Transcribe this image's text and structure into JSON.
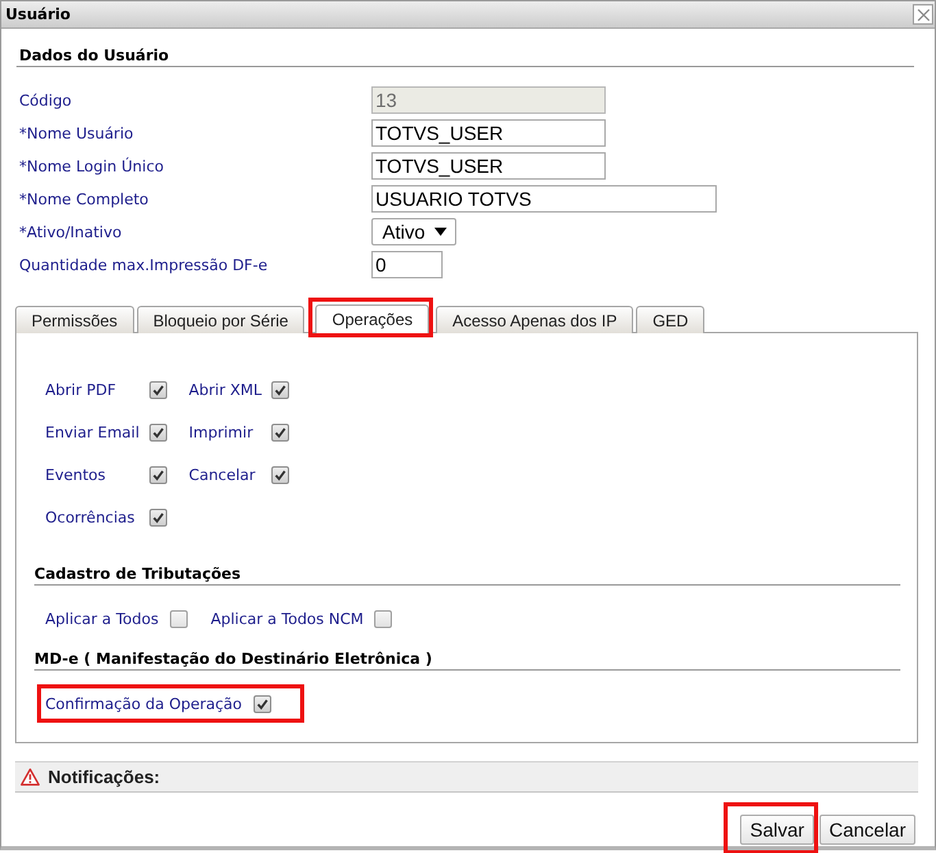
{
  "window": {
    "title": "Usuário"
  },
  "user": {
    "title": "Dados do Usuário",
    "fields": [
      {
        "kind": "text",
        "label": "Código",
        "value": "13",
        "disabled": true
      },
      {
        "kind": "text",
        "label": "*Nome Usuário",
        "value": "TOTVS_USER",
        "disabled": false
      },
      {
        "kind": "text",
        "label": "*Nome Login Único",
        "value": "TOTVS_USER",
        "disabled": false
      },
      {
        "kind": "longtext",
        "label": "*Nome Completo",
        "value": "USUARIO TOTVS",
        "disabled": false
      },
      {
        "kind": "select",
        "label": "*Ativo/Inativo",
        "value": "Ativo",
        "disabled": false
      },
      {
        "kind": "number",
        "label": "Quantidade max.Impressão DF-e",
        "value": "0",
        "disabled": false
      }
    ]
  },
  "tabs": [
    {
      "label": "Permissões",
      "selected": false,
      "highlighted": false
    },
    {
      "label": "Bloqueio por Série",
      "selected": false,
      "highlighted": false
    },
    {
      "label": "Operações",
      "selected": true,
      "highlighted": true
    },
    {
      "label": "Acesso Apenas dos IP",
      "selected": false,
      "highlighted": false
    },
    {
      "label": "GED",
      "selected": false,
      "highlighted": false
    }
  ],
  "operations": {
    "rows": [
      {
        "options": [
          {
            "label": "Abrir PDF",
            "checked": true
          },
          {
            "label": "Abrir XML",
            "checked": true
          }
        ]
      },
      {
        "options": [
          {
            "label": "Enviar Email",
            "checked": true
          },
          {
            "label": "Imprimir",
            "checked": true
          }
        ]
      },
      {
        "options": [
          {
            "label": "Eventos",
            "checked": true
          },
          {
            "label": "Cancelar",
            "checked": true
          }
        ]
      },
      {
        "options": [
          {
            "label": "Ocorrências",
            "checked": true
          }
        ]
      }
    ]
  },
  "taxes": {
    "title": "Cadastro de Tributações",
    "options": [
      {
        "label": "Aplicar a Todos",
        "checked": false
      },
      {
        "label": "Aplicar a Todos NCM",
        "checked": false
      }
    ]
  },
  "mde": {
    "title": "MD-e ( Manifestação do Destinário Eletrônica )",
    "options": [
      {
        "label": "Confirmação da Operação",
        "checked": true,
        "highlighted": true
      }
    ]
  },
  "notifications": {
    "title": "Notificações:"
  },
  "buttons": [
    {
      "label": "Salvar",
      "highlighted": true
    },
    {
      "label": "Cancelar",
      "highlighted": false
    }
  ]
}
